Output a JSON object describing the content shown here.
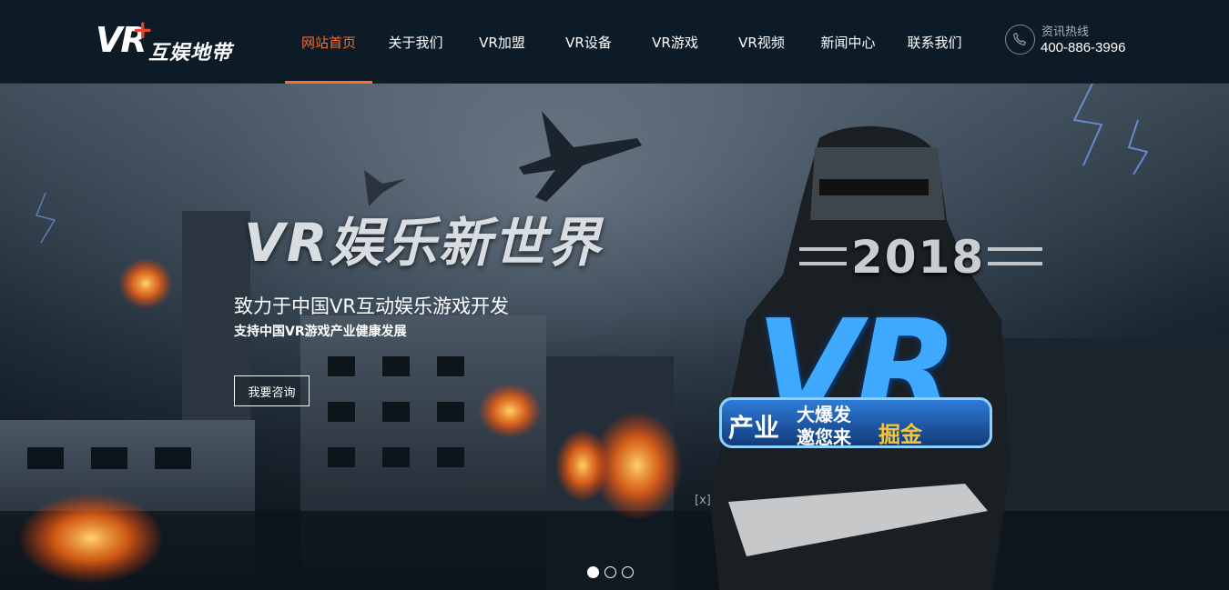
{
  "header": {
    "logo": {
      "vr": "VR",
      "plus": "+",
      "name": "互娱地带"
    },
    "nav": [
      {
        "label": "网站首页",
        "active": true
      },
      {
        "label": "关于我们",
        "active": false
      },
      {
        "label": "VR加盟",
        "active": false
      },
      {
        "label": "VR设备",
        "active": false
      },
      {
        "label": "VR游戏",
        "active": false
      },
      {
        "label": "VR视频",
        "active": false
      },
      {
        "label": "新闻中心",
        "active": false
      },
      {
        "label": "联系我们",
        "active": false
      }
    ],
    "hotline": {
      "label": "资讯热线",
      "number": "400-886-3996",
      "icon": "phone-icon"
    }
  },
  "banner": {
    "title": "VR娱乐新世界",
    "subtitle": "致力于中国VR互动娱乐游戏开发",
    "subtitle2": "支持中国VR游戏产业健康发展",
    "button": "我要咨询",
    "close": "[x]",
    "slides": 3,
    "active_slide": 1,
    "promo": {
      "year": "2018",
      "vr": "VR",
      "chanye": "产业",
      "line1": "大爆发",
      "line2": "邀您来",
      "jue": "掘金"
    }
  },
  "colors": {
    "accent": "#ff6a2a",
    "header_bg": "#0d1b26"
  }
}
